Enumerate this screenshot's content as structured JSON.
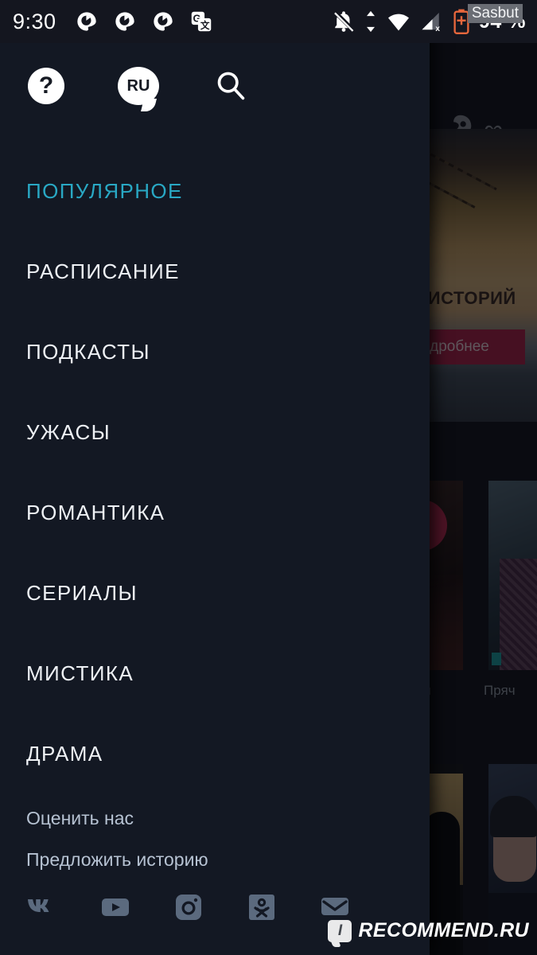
{
  "status_bar": {
    "time": "9:30",
    "left_icons": [
      "chat-bubble-notification",
      "chat-bubble-notification",
      "chat-bubble-notification",
      "google-translate"
    ],
    "right_icons": [
      "notifications-off",
      "data-transfer-arrows",
      "wifi-full",
      "cellular-no-sim",
      "battery-charging"
    ],
    "battery_text": "94 %",
    "overlay_tag": "Sasbut",
    "background": "#14161f"
  },
  "drawer": {
    "background": "#131823",
    "accent": "#29a8c4",
    "toolbar": {
      "help_label": "?",
      "language_label": "RU",
      "search_label": "search-icon"
    },
    "menu_items": [
      {
        "label": "ПОПУЛЯРНОЕ",
        "active": true
      },
      {
        "label": "РАСПИСАНИЕ",
        "active": false
      },
      {
        "label": "ПОДКАСТЫ",
        "active": false
      },
      {
        "label": "УЖАСЫ",
        "active": false
      },
      {
        "label": "РОМАНТИКА",
        "active": false
      },
      {
        "label": "СЕРИАЛЫ",
        "active": false
      },
      {
        "label": "МИСТИКА",
        "active": false
      },
      {
        "label": "ДРАМА",
        "active": false
      }
    ],
    "links": [
      {
        "label": "Оценить нас"
      },
      {
        "label": "Предложить историю"
      }
    ],
    "social": [
      {
        "name": "vk-icon",
        "label": "VK"
      },
      {
        "name": "youtube-icon",
        "label": "YouTube"
      },
      {
        "name": "instagram-icon",
        "label": "Instagram"
      },
      {
        "name": "odnoklassniki-icon",
        "label": "OK"
      },
      {
        "name": "email-icon",
        "label": "Email"
      }
    ]
  },
  "app_content": {
    "toolbar": {
      "rocket_label": "rocket-icon",
      "infinity_label": "∞"
    },
    "hero": {
      "title_fragment": "Е ИСТОРИЙ",
      "cta_fragment": "одробнее",
      "cta_color": "#b4224a"
    },
    "cards": [
      {
        "label_fragment": "ая"
      },
      {
        "label_fragment": "Пряч"
      }
    ]
  },
  "watermark": {
    "logo_letter": "I",
    "text": "RECOMMEND.RU"
  }
}
